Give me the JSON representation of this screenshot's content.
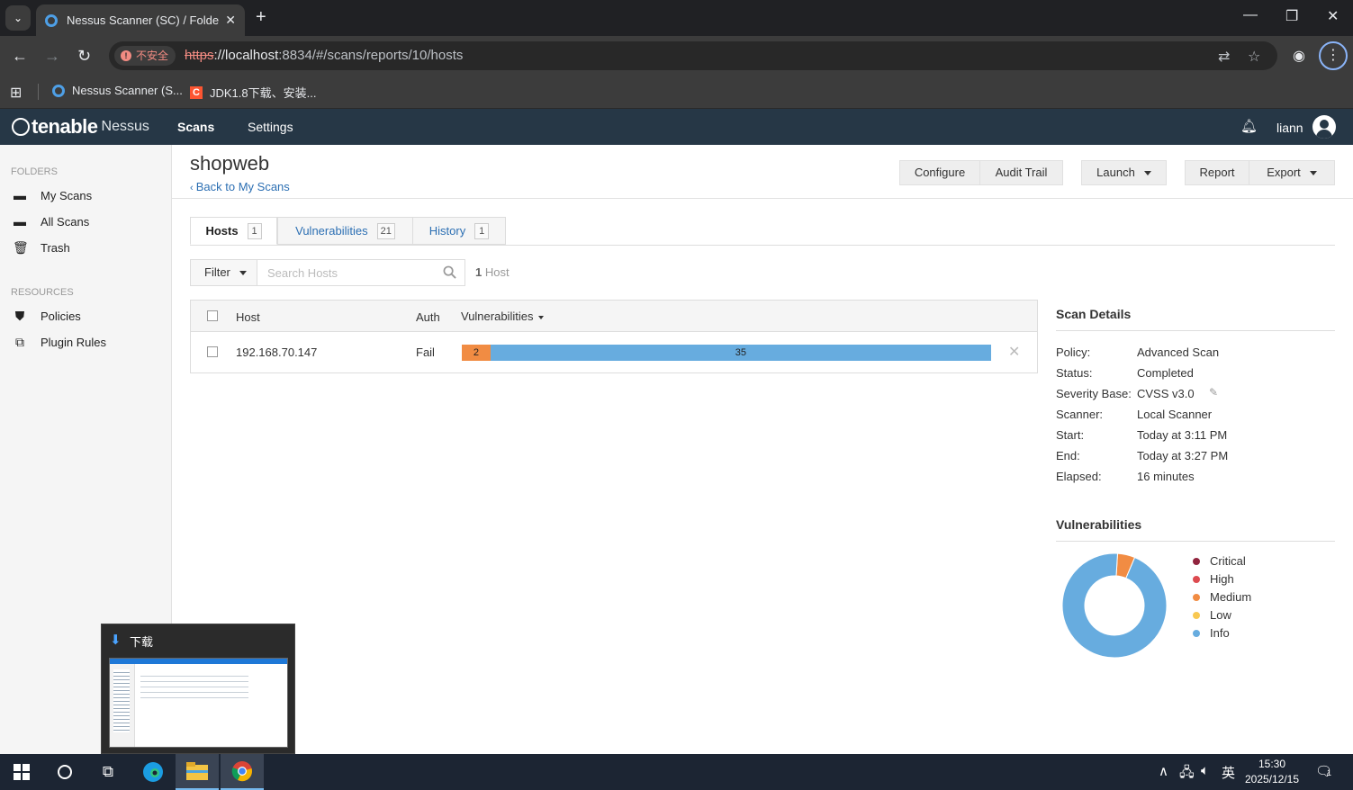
{
  "browser": {
    "tab_title": "Nessus Scanner (SC) / Folders / View Scan",
    "insecure_label": "不安全",
    "url_proto": "https",
    "url_host": "://localhost",
    "url_rest": ":8834/#/scans/reports/10/hosts",
    "bookmarks": [
      {
        "label": "Nessus Scanner (S..."
      },
      {
        "label": "JDK1.8下载、安装..."
      }
    ]
  },
  "app": {
    "brand": "tenable",
    "product": "Nessus",
    "nav": [
      {
        "label": "Scans",
        "active": true
      },
      {
        "label": "Settings",
        "active": false
      }
    ],
    "username": "liann"
  },
  "sidebar": {
    "folders_heading": "FOLDERS",
    "folders": [
      {
        "label": "My Scans",
        "icon": "folder-icon"
      },
      {
        "label": "All Scans",
        "icon": "folder-icon"
      },
      {
        "label": "Trash",
        "icon": "trash-icon"
      }
    ],
    "resources_heading": "RESOURCES",
    "resources": [
      {
        "label": "Policies",
        "icon": "shield-icon"
      },
      {
        "label": "Plugin Rules",
        "icon": "plugin-icon"
      }
    ]
  },
  "scan": {
    "title": "shopweb",
    "back_link": "Back to My Scans"
  },
  "actions": {
    "configure": "Configure",
    "audit_trail": "Audit Trail",
    "launch": "Launch",
    "report": "Report",
    "export": "Export"
  },
  "tabs": [
    {
      "label": "Hosts",
      "count": "1",
      "active": true
    },
    {
      "label": "Vulnerabilities",
      "count": "21",
      "active": false
    },
    {
      "label": "History",
      "count": "1",
      "active": false
    }
  ],
  "filter": {
    "label": "Filter",
    "placeholder": "Search Hosts",
    "count_num": "1",
    "count_label": "Host"
  },
  "hosts_table": {
    "headers": {
      "host": "Host",
      "auth": "Auth",
      "vulnerabilities": "Vulnerabilities"
    },
    "rows": [
      {
        "host": "192.168.70.147",
        "auth": "Fail",
        "medium": 2,
        "info": 35
      }
    ]
  },
  "scan_details": {
    "title": "Scan Details",
    "items": [
      {
        "label": "Policy:",
        "value": "Advanced Scan"
      },
      {
        "label": "Status:",
        "value": "Completed"
      },
      {
        "label": "Severity Base:",
        "value": "CVSS v3.0"
      },
      {
        "label": "Scanner:",
        "value": "Local Scanner"
      },
      {
        "label": "Start:",
        "value": "Today at 3:11 PM"
      },
      {
        "label": "End:",
        "value": "Today at 3:27 PM"
      },
      {
        "label": "Elapsed:",
        "value": "16 minutes"
      }
    ]
  },
  "vulnerabilities_panel": {
    "title": "Vulnerabilities",
    "legend": [
      {
        "label": "Critical",
        "color": "#91243e"
      },
      {
        "label": "High",
        "color": "#dd4b50"
      },
      {
        "label": "Medium",
        "color": "#f18c43"
      },
      {
        "label": "Low",
        "color": "#f8c851"
      },
      {
        "label": "Info",
        "color": "#67acdf"
      }
    ]
  },
  "chart_data": {
    "type": "pie",
    "categories": [
      "Critical",
      "High",
      "Medium",
      "Low",
      "Info"
    ],
    "values": [
      0,
      0,
      2,
      0,
      35
    ],
    "title": "Vulnerabilities"
  },
  "download_popup": {
    "title": "下载"
  },
  "taskbar": {
    "time": "15:30",
    "date": "2025/12/15",
    "ime": "英",
    "notification_count": "1"
  }
}
